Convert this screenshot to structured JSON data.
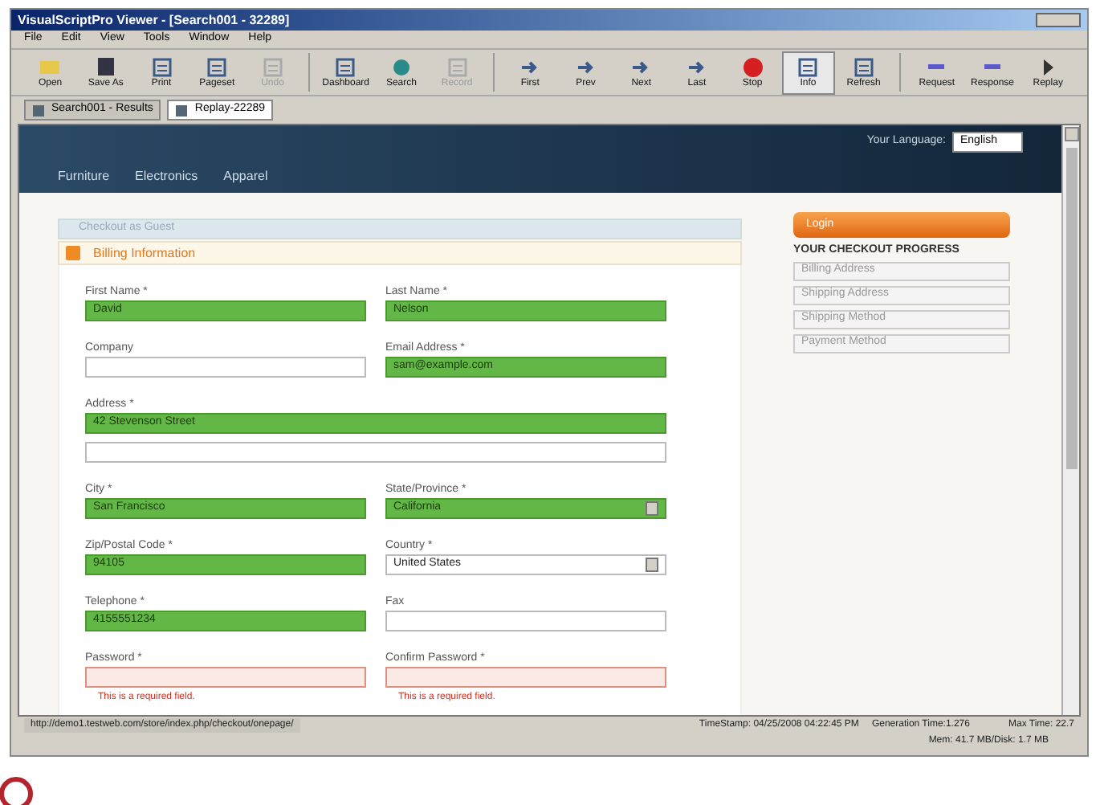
{
  "window": {
    "title": "VisualScriptPro Viewer - [Search001 - 32289]"
  },
  "menu": [
    "File",
    "Edit",
    "View",
    "Tools",
    "Window",
    "Help"
  ],
  "toolbar": [
    {
      "label": "Open",
      "disabled": false,
      "selected": false
    },
    {
      "label": "Save As",
      "disabled": false,
      "selected": false
    },
    {
      "label": "Print",
      "disabled": false,
      "selected": false
    },
    {
      "label": "Pageset",
      "disabled": false,
      "selected": false
    },
    {
      "label": "Undo",
      "disabled": true,
      "selected": false
    },
    {
      "label": "Dashboard",
      "disabled": false,
      "selected": false
    },
    {
      "label": "Search",
      "disabled": false,
      "selected": false
    },
    {
      "label": "Record",
      "disabled": true,
      "selected": false
    },
    {
      "label": "First",
      "disabled": false,
      "selected": false
    },
    {
      "label": "Prev",
      "disabled": false,
      "selected": false
    },
    {
      "label": "Next",
      "disabled": false,
      "selected": false
    },
    {
      "label": "Last",
      "disabled": false,
      "selected": false
    },
    {
      "label": "Stop",
      "disabled": false,
      "selected": false
    },
    {
      "label": "Info",
      "disabled": false,
      "selected": true
    },
    {
      "label": "Refresh",
      "disabled": false,
      "selected": false
    },
    {
      "label": "Request",
      "disabled": false,
      "selected": false
    },
    {
      "label": "Response",
      "disabled": false,
      "selected": false
    },
    {
      "label": "Replay",
      "disabled": false,
      "selected": false
    }
  ],
  "doc_tabs": [
    {
      "label": "Search001 - Results",
      "selected": false
    },
    {
      "label": "Replay-22289",
      "selected": true
    }
  ],
  "store": {
    "language_label": "Your Language:",
    "language": "English",
    "nav": [
      "Furniture",
      "Electronics",
      "Apparel"
    ],
    "collapsed_step": "Checkout as Guest",
    "section_title": "Billing Information",
    "rows": [
      [
        {
          "label": "First Name *",
          "value": "David",
          "kind": "text",
          "valid": true,
          "invalid": false
        },
        {
          "label": "Last Name *",
          "value": "Nelson",
          "kind": "text",
          "valid": true,
          "invalid": false
        }
      ],
      [
        {
          "label": "Company",
          "kind": "text",
          "valid": false,
          "invalid": false
        },
        {
          "label": "Email Address *",
          "value": "sam@example.com",
          "kind": "text",
          "valid": true,
          "invalid": false
        }
      ],
      [
        {
          "label": "Address *",
          "value": "42 Stevenson Street",
          "kind": "wide",
          "valid": true,
          "invalid": false
        }
      ],
      [
        {
          "kind": "wide",
          "valid": false,
          "invalid": false
        }
      ],
      [
        {
          "label": "City *",
          "value": "San Francisco",
          "kind": "text",
          "valid": true,
          "invalid": false
        },
        {
          "label": "State/Province *",
          "value": "California",
          "kind": "select",
          "valid": true,
          "invalid": false
        }
      ],
      [
        {
          "label": "Zip/Postal Code *",
          "value": "94105",
          "kind": "text",
          "valid": true,
          "invalid": false
        },
        {
          "label": "Country *",
          "value": "United States",
          "kind": "select",
          "valid": false,
          "invalid": false
        }
      ],
      [
        {
          "label": "Telephone *",
          "value": "4155551234",
          "kind": "text",
          "valid": true,
          "invalid": false
        },
        {
          "label": "Fax",
          "kind": "text",
          "valid": false,
          "invalid": false
        }
      ],
      [
        {
          "label": "Password *",
          "kind": "text",
          "valid": false,
          "invalid": true,
          "error": "This is a required field."
        },
        {
          "label": "Confirm Password *",
          "kind": "text",
          "valid": false,
          "invalid": true,
          "error": "This is a required field."
        }
      ]
    ],
    "login_button": "Login",
    "progress_title": "YOUR CHECKOUT PROGRESS",
    "progress_steps": [
      "Billing Address",
      "Shipping Address",
      "Shipping Method",
      "Payment Method"
    ]
  },
  "status_bar": {
    "url": "http://demo1.testweb.com/store/index.php/checkout/onepage/",
    "timestamp": "TimeStamp: 04/25/2008 04:22:45 PM",
    "generation": "Generation Time:1.276",
    "max_time": "Max Time: 22.7",
    "memory": "Mem: 41.7 MB/Disk: 1.7 MB"
  }
}
